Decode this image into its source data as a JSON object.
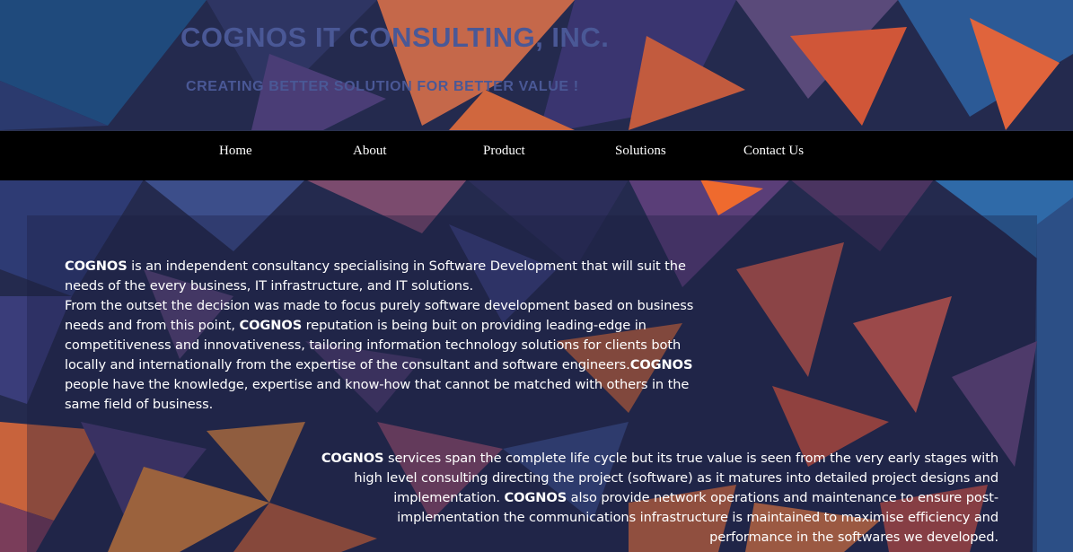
{
  "header": {
    "title": "COGNOS IT CONSULTING, INC.",
    "tagline": "CREATING BETTER SOLUTION FOR BETTER VALUE !"
  },
  "nav": {
    "items": [
      {
        "label": "Home"
      },
      {
        "label": "About"
      },
      {
        "label": "Product"
      },
      {
        "label": "Solutions"
      },
      {
        "label": "Contact Us"
      }
    ]
  },
  "content": {
    "brand": "COGNOS",
    "paragraph1": {
      "part1": " is an independent consultancy specialising in Software Development that will suit the needs of the every business, IT infrastructure, and IT solutions.",
      "part2": "From the outset the decision was made to focus purely software development based on business needs and from this point, ",
      "part3": " reputation is being buit on providing leading-edge in competitiveness and innovativeness, tailoring information technology solutions for clients both locally and internationally from the expertise of the consultant and software engineers.",
      "part4": " people have the knowledge, expertise and know-how that cannot be matched with others in the same field of business."
    },
    "paragraph2": {
      "part1": " services span the complete life cycle but its true value is seen from the very early stages with high level consulting directing the project (software) as it matures into detailed project designs and implementation. ",
      "part2": " also provide network operations and maintenance to ensure post-implementation the communications infrastructure is maintained to maximise efficiency and performance in the softwares we developed."
    }
  },
  "colors": {
    "title": "#4a5896",
    "navbar": "#000000",
    "text": "#ffffff",
    "background_dark": "#1c2240",
    "accent_orange": "#e8643c",
    "accent_blue": "#3d6db0"
  }
}
